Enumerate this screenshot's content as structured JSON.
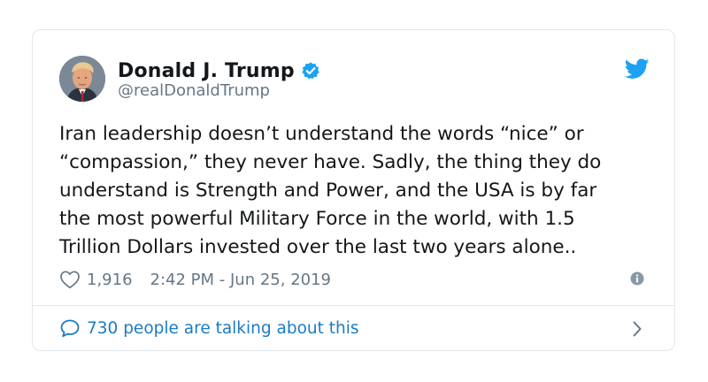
{
  "tweet": {
    "author_name": "Donald J. Trump",
    "author_handle": "@realDonaldTrump",
    "text": "Iran leadership doesn’t understand the words “nice” or\n“compassion,” they never have. Sadly, the thing they do\nunderstand is Strength and Power, and the USA is by far\nthe most powerful Military Force in the world, with 1.5\nTrillion Dollars invested over the last two years alone..",
    "like_count": "1,916",
    "timestamp": "2:42 PM - Jun 25, 2019",
    "talking_label": "730 people are talking about this"
  },
  "icons": {
    "verified": "verified-badge-icon",
    "brand": "twitter-bird-icon",
    "like": "heart-icon",
    "info": "info-icon",
    "reply": "speech-bubble-icon",
    "chevron": "chevron-right-icon"
  },
  "colors": {
    "brand_blue": "#1da1f2",
    "link_blue": "#1b7bc4",
    "secondary_text": "#657786",
    "border": "#e1e8ed"
  }
}
